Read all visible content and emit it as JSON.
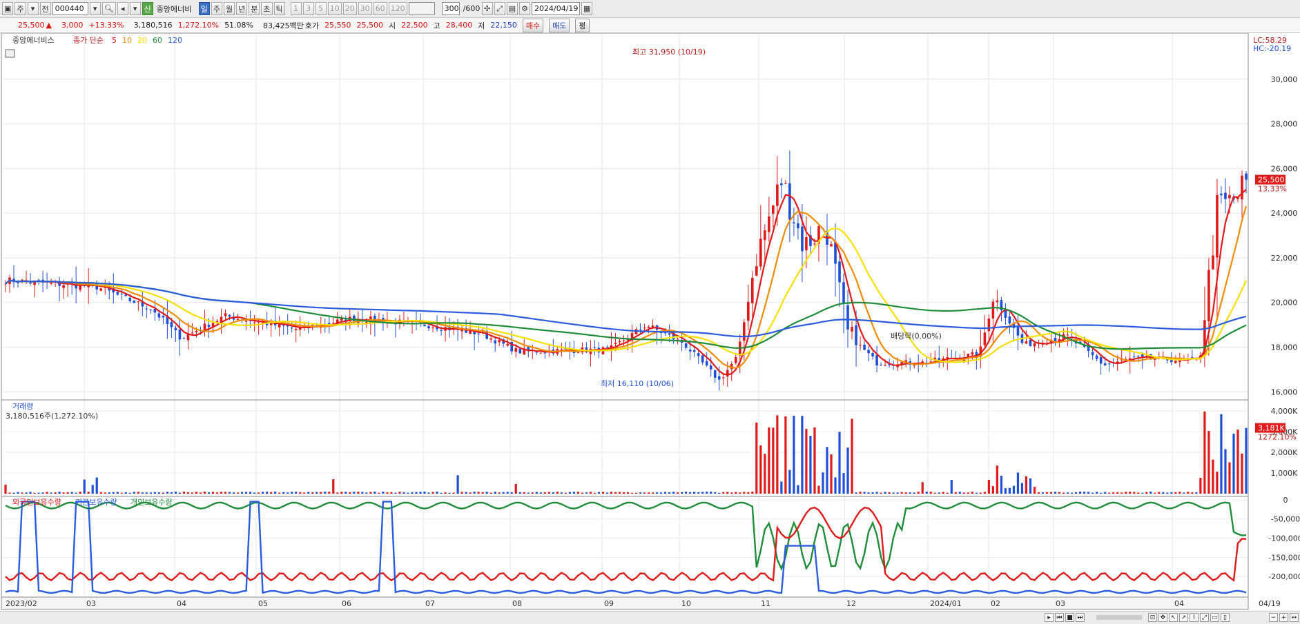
{
  "toolbar": {
    "period_main": "주",
    "jeon": "전",
    "code": "000440",
    "credit_badge": "신",
    "name": "중앙에너비",
    "periods": [
      "일",
      "주",
      "월",
      "년",
      "분",
      "초",
      "틱"
    ],
    "active_period": "일",
    "intervals": [
      "1",
      "3",
      "5",
      "10",
      "20",
      "30",
      "60",
      "120"
    ],
    "count": "300",
    "count_total": "/600",
    "date": "2024/04/19"
  },
  "quote": {
    "price": "25,500",
    "change_arrow": "▲",
    "change": "3,000",
    "change_pct": "+13.33%",
    "volume": "3,180,516",
    "volume_ratio": "1,272.10%",
    "turnover": "51.08%",
    "amount": "83,425백만",
    "hoga_label": "호가",
    "ask": "25,550",
    "bid": "25,500",
    "open_label": "시",
    "open": "22,500",
    "high_label": "고",
    "high": "28,400",
    "low_label": "저",
    "low": "22,150",
    "buy": "매수",
    "sell": "매도",
    "eval": "평"
  },
  "legend": {
    "name": "중앙에너비스",
    "type": "종가 단순",
    "ma": [
      {
        "label": "5",
        "color": "#e01a1a"
      },
      {
        "label": "10",
        "color": "#f08c00"
      },
      {
        "label": "20",
        "color": "#f5e000"
      },
      {
        "label": "60",
        "color": "#1f8c3a"
      },
      {
        "label": "120",
        "color": "#2b5ce0"
      }
    ]
  },
  "chart_data": [
    {
      "type": "candlestick",
      "title": "중앙에너비스",
      "y_ticks": [
        "30,000",
        "28,000",
        "26,000",
        "24,000",
        "22,000",
        "20,000",
        "18,000",
        "16,000"
      ],
      "ylim": [
        15700,
        32000
      ],
      "x_labels": [
        "2023/02",
        "03",
        "04",
        "05",
        "06",
        "07",
        "08",
        "09",
        "10",
        "11",
        "12",
        "2024/01",
        "02",
        "03",
        "04",
        "04/19"
      ],
      "annotations": {
        "high": "최고 31,950 (10/19)",
        "low": "최저 16,110 (10/06)",
        "dividend": "배당락(0.00%)"
      },
      "current_price": "25,500",
      "current_pct": "13.33%",
      "lc": "LC:58.29",
      "hc": "HC:-20.19",
      "grid": true
    },
    {
      "type": "bar",
      "title": "거래량",
      "info": "3,180,516주(1,272.10%)",
      "y_ticks": [
        "4,000K",
        "3,000K",
        "2,000K",
        "1,000K"
      ],
      "ylim": [
        0,
        4400
      ],
      "current": "3,181K",
      "current_pct": "1272.10%"
    },
    {
      "type": "line",
      "series": [
        {
          "name": "외국인보유수량",
          "color": "#e01a1a"
        },
        {
          "name": "기관보유수량",
          "color": "#2b5ce0"
        },
        {
          "name": "개인보유수량",
          "color": "#1f8c3a"
        }
      ],
      "y_ticks": [
        "0",
        "-50,000",
        "-100,000",
        "-150,000",
        "-200,000"
      ],
      "ylim": [
        -250000,
        5000
      ]
    }
  ]
}
